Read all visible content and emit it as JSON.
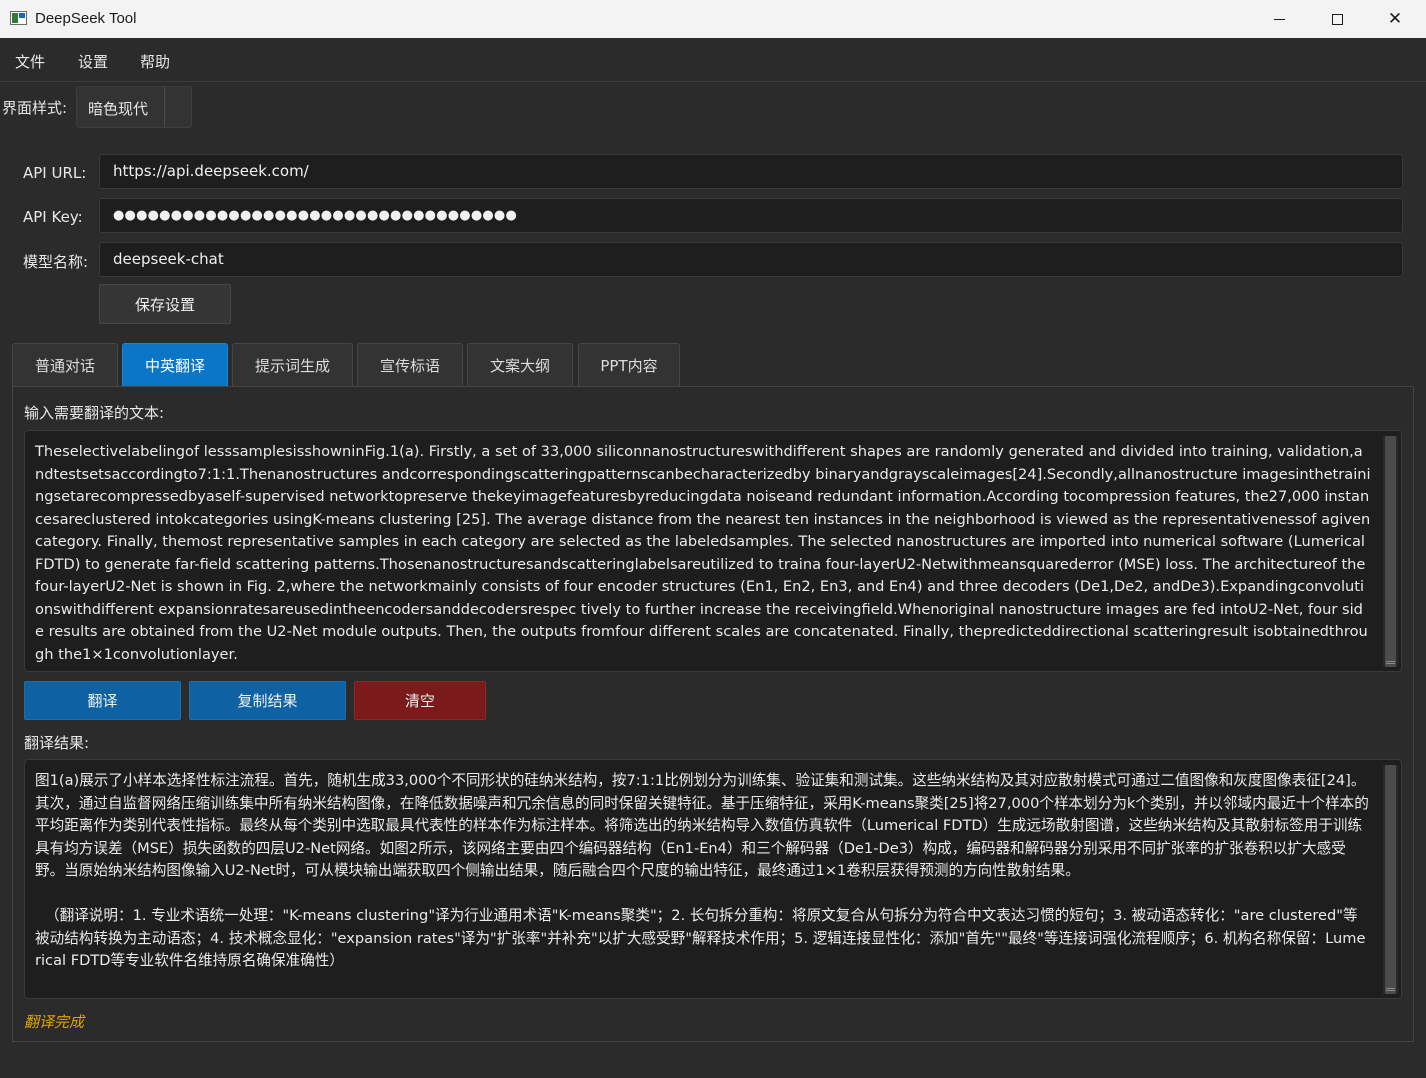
{
  "window": {
    "title": "DeepSeek Tool"
  },
  "menu": {
    "file": "文件",
    "settings": "设置",
    "help": "帮助"
  },
  "style": {
    "label": "界面样式:",
    "value": "暗色现代"
  },
  "form": {
    "api_url_label": "API URL:",
    "api_url_value": "https://api.deepseek.com/",
    "api_key_label": "API Key:",
    "api_key_value": "●●●●●●●●●●●●●●●●●●●●●●●●●●●●●●●●●●●",
    "model_label": "模型名称:",
    "model_value": "deepseek-chat",
    "save_button": "保存设置"
  },
  "tabs": [
    {
      "label": "普通对话",
      "active": false
    },
    {
      "label": "中英翻译",
      "active": true
    },
    {
      "label": "提示词生成",
      "active": false
    },
    {
      "label": "宣传标语",
      "active": false
    },
    {
      "label": "文案大纲",
      "active": false
    },
    {
      "label": "PPT内容",
      "active": false
    }
  ],
  "translate": {
    "input_label": "输入需要翻译的文本:",
    "input_text": "Theselectivelabelingof lesssamplesisshowninFig.1(a). Firstly, a set of 33,000 siliconnanostructureswithdifferent shapes are randomly generated and divided into training, validation,andtestsetsaccordingto7:1:1.Thenanostructures andcorrespondingscatteringpatternscanbecharacterizedby binaryandgrayscaleimages[24].Secondly,allnanostructure imagesinthetrainingsetarecompressedbyaself-supervised networktopreserve thekeyimagefeaturesbyreducingdata noiseand redundant information.According tocompression features, the27,000 instancesareclustered intokcategories usingK-means clustering [25]. The average distance from the nearest ten instances in the neighborhood is viewed as the representativenessof agivencategory. Finally, themost representative samples in each category are selected as the labeledsamples. The selected nanostructures are imported into numerical software (Lumerical FDTD) to generate far-field scattering patterns.Thosenanostructuresandscatteringlabelsareutilized to traina four-layerU2-Netwithmeansquarederror (MSE) loss. The architectureof the four-layerU2-Net is shown in Fig. 2,where the networkmainly consists of four encoder structures (En1, En2, En3, and En4) and three decoders (De1,De2, andDe3).Expandingconvolutionswithdifferent expansionratesareusedintheencodersanddecodersrespec tively to further increase the receivingfield.Whenoriginal nanostructure images are fed intoU2-Net, four side results are obtained from the U2-Net module outputs. Then, the outputs fromfour different scales are concatenated. Finally, thepredicteddirectional scatteringresult isobtainedthrough the1×1convolutionlayer.",
    "translate_button": "翻译",
    "copy_button": "复制结果",
    "clear_button": "清空",
    "result_label": "翻译结果:",
    "result_text": "图1(a)展示了小样本选择性标注流程。首先，随机生成33,000个不同形状的硅纳米结构，按7:1:1比例划分为训练集、验证集和测试集。这些纳米结构及其对应散射模式可通过二值图像和灰度图像表征[24]。其次，通过自监督网络压缩训练集中所有纳米结构图像，在降低数据噪声和冗余信息的同时保留关键特征。基于压缩特征，采用K-means聚类[25]将27,000个样本划分为k个类别，并以邻域内最近十个样本的平均距离作为类别代表性指标。最终从每个类别中选取最具代表性的样本作为标注样本。将筛选出的纳米结构导入数值仿真软件（Lumerical FDTD）生成远场散射图谱，这些纳米结构及其散射标签用于训练具有均方误差（MSE）损失函数的四层U2-Net网络。如图2所示，该网络主要由四个编码器结构（En1-En4）和三个解码器（De1-De3）构成，编码器和解码器分别采用不同扩张率的扩张卷积以扩大感受野。当原始纳米结构图像输入U2-Net时，可从模块输出端获取四个侧输出结果，随后融合四个尺度的输出特征，最终通过1×1卷积层获得预测的方向性散射结果。",
    "result_note": "（翻译说明：1. 专业术语统一处理：\"K-means clustering\"译为行业通用术语\"K-means聚类\"；2. 长句拆分重构：将原文复合从句拆分为符合中文表达习惯的短句；3. 被动语态转化：\"are clustered\"等被动结构转换为主动语态；4. 技术概念显化：\"expansion rates\"译为\"扩张率\"并补充\"以扩大感受野\"解释技术作用；5. 逻辑连接显性化：添加\"首先\"\"最终\"等连接词强化流程顺序；6. 机构名称保留：Lumerical FDTD等专业软件名维持原名确保准确性）",
    "status": "翻译完成"
  },
  "colors": {
    "accent": "#0b75c6",
    "clear_button": "#7a1a1a",
    "status": "#e0a400"
  }
}
